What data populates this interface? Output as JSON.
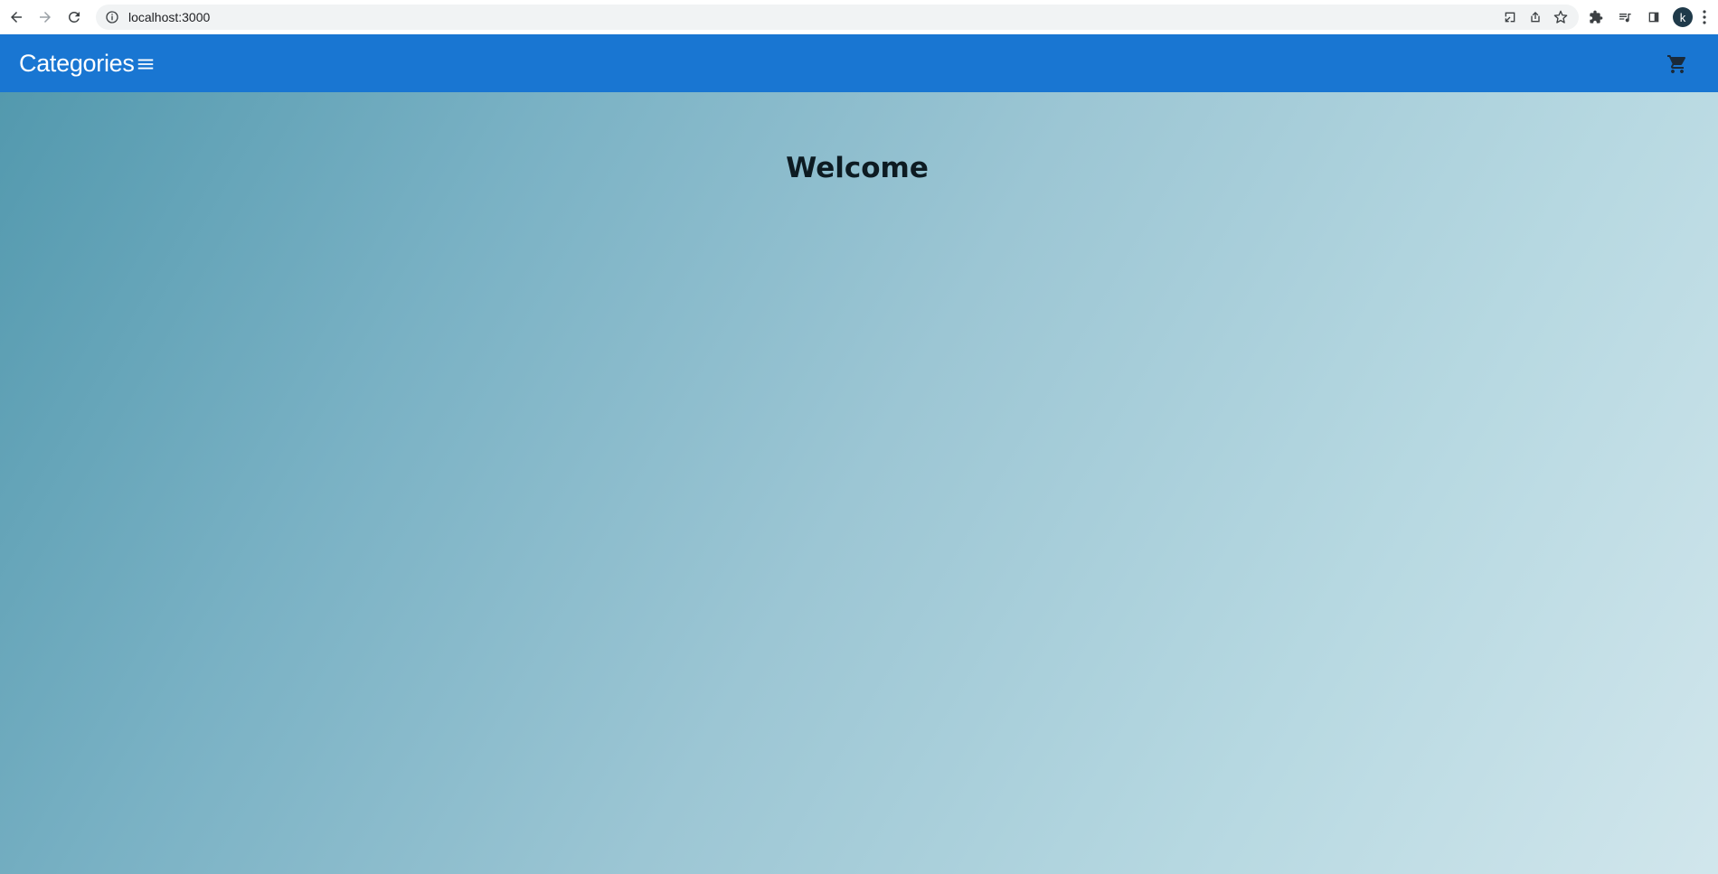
{
  "browser": {
    "url": "localhost:3000",
    "avatar_letter": "k",
    "icons": [
      "back-icon",
      "forward-icon",
      "reload-icon",
      "info-icon",
      "install-icon",
      "share-icon",
      "bookmark-star-icon",
      "extensions-icon",
      "media-queue-icon",
      "side-panel-icon",
      "more-icon"
    ]
  },
  "header": {
    "categories_label": "Categories",
    "menu_icon": "menu-icon",
    "cart_icon": "cart-icon",
    "background_color": "#1976d2"
  },
  "main": {
    "heading": "Welcome"
  }
}
